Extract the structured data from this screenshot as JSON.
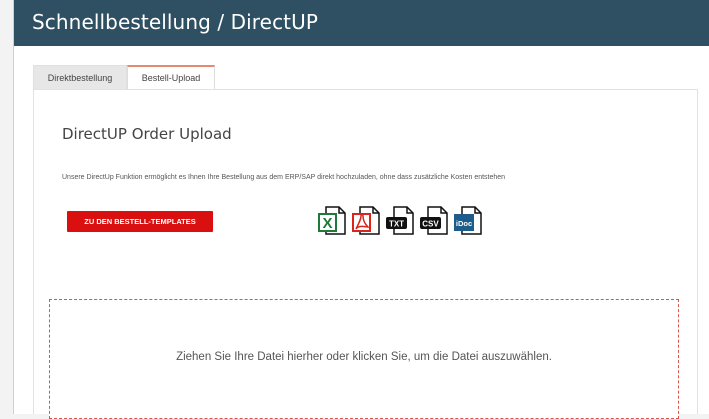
{
  "header": {
    "title": "Schnellbestellung / DirectUP"
  },
  "tabs": [
    {
      "label": "Direktbestellung",
      "active": false
    },
    {
      "label": "Bestell-Upload",
      "active": true
    }
  ],
  "section": {
    "title": "DirectUP Order Upload",
    "description": "Unsere DirectUp Funktion ermöglicht es Ihnen Ihre Bestellung aus dem ERP/SAP direkt hochzuladen, ohne dass zusätzliche Kosten entstehen"
  },
  "cta": {
    "label": "ZU DEN BESTELL-TEMPLATES",
    "color": "#d9100f"
  },
  "file_types": [
    {
      "icon": "excel-file-icon",
      "label": "X",
      "color": "#1f7a3a"
    },
    {
      "icon": "pdf-file-icon",
      "label": "",
      "color": "#d9251d"
    },
    {
      "icon": "txt-file-icon",
      "label": "TXT",
      "color": "#111111"
    },
    {
      "icon": "csv-file-icon",
      "label": "CSV",
      "color": "#111111"
    },
    {
      "icon": "idoc-file-icon",
      "label": "iDoc",
      "color": "#1c5d8c"
    }
  ],
  "dropzone": {
    "text": "Ziehen Sie Ihre Datei hierher oder klicken Sie, um die Datei auszuwählen."
  },
  "colors": {
    "header_bg": "#2f4f63",
    "tab_accent": "#e58a70",
    "dropzone_border": "#d9534f"
  }
}
